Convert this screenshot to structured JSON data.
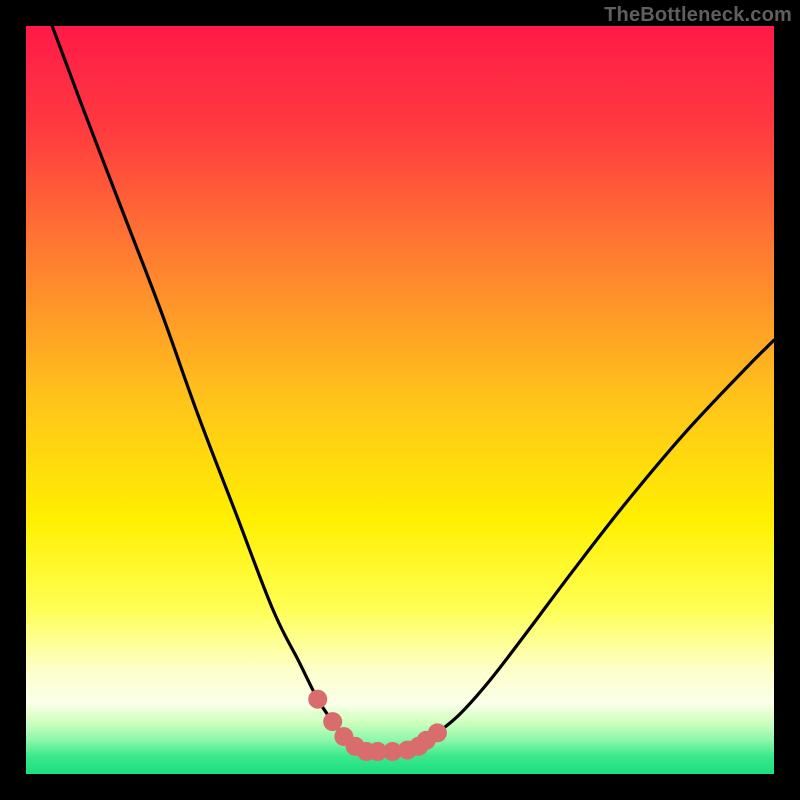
{
  "watermark": "TheBottleneck.com",
  "chart_data": {
    "type": "line",
    "title": "",
    "xlabel": "",
    "ylabel": "",
    "xlim": [
      0,
      100
    ],
    "ylim": [
      0,
      100
    ],
    "grid": false,
    "gradient_stops": [
      {
        "offset": 0.0,
        "color": "#ff1a48"
      },
      {
        "offset": 0.14,
        "color": "#ff3b3f"
      },
      {
        "offset": 0.3,
        "color": "#ff7a32"
      },
      {
        "offset": 0.5,
        "color": "#ffc41a"
      },
      {
        "offset": 0.66,
        "color": "#fff000"
      },
      {
        "offset": 0.78,
        "color": "#ffff55"
      },
      {
        "offset": 0.86,
        "color": "#fdffc8"
      },
      {
        "offset": 0.905,
        "color": "#fbffe9"
      },
      {
        "offset": 0.93,
        "color": "#d0ffc0"
      },
      {
        "offset": 0.955,
        "color": "#8cf7aa"
      },
      {
        "offset": 0.975,
        "color": "#3fe98d"
      },
      {
        "offset": 1.0,
        "color": "#18df7e"
      }
    ],
    "series": [
      {
        "name": "bottleneck-curve",
        "stroke": "#000000",
        "x": [
          3.5,
          8.0,
          13.0,
          18.0,
          23.0,
          28.0,
          33.0,
          36.5,
          39.0,
          41.0,
          42.5,
          44.0,
          45.5,
          47.0,
          49.0,
          51.0,
          53.0,
          55.0,
          58.0,
          62.0,
          67.0,
          73.0,
          80.0,
          88.0,
          96.0,
          100.0
        ],
        "values": [
          100.0,
          88.0,
          75.0,
          62.0,
          48.0,
          35.0,
          22.0,
          15.0,
          10.0,
          7.0,
          5.0,
          3.7,
          3.0,
          3.0,
          3.0,
          3.2,
          4.0,
          5.5,
          8.0,
          12.5,
          19.0,
          27.0,
          36.0,
          45.5,
          54.0,
          58.0
        ]
      },
      {
        "name": "highlight-dots",
        "color": "#d96c6c",
        "type": "scatter",
        "x": [
          39.0,
          41.0,
          42.5,
          44.0,
          45.5,
          47.0,
          49.0,
          51.0,
          52.5,
          53.5,
          55.0
        ],
        "values": [
          10.0,
          7.0,
          5.0,
          3.7,
          3.0,
          3.0,
          3.0,
          3.2,
          3.7,
          4.5,
          5.5
        ]
      }
    ]
  }
}
